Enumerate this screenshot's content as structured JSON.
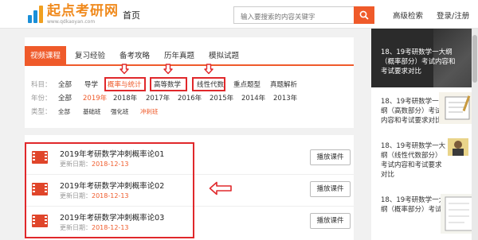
{
  "header": {
    "logo_name": "起点考研网",
    "logo_url": "www.qdkaoyan.com",
    "home_label": "首页",
    "search_placeholder": "输入要搜索的内容关键字",
    "advanced_search": "高级检索",
    "login": "登录/注册"
  },
  "tabs": [
    "视频课程",
    "复习经验",
    "备考攻略",
    "历年真题",
    "模拟试题"
  ],
  "filters": {
    "subject": {
      "label": "科目：",
      "options": [
        "全部",
        "导学",
        "概率与统计",
        "高等数学",
        "线性代数",
        "重点题型",
        "真题解析"
      ]
    },
    "year": {
      "label": "年份：",
      "options": [
        "全部",
        "2019年",
        "2018年",
        "2017年",
        "2016年",
        "2015年",
        "2014年",
        "2013年"
      ]
    },
    "type": {
      "label": "类型：",
      "options": [
        "全部",
        "基础班",
        "强化班",
        "冲刺班"
      ]
    }
  },
  "courses": [
    {
      "title": "2019年考研数学冲刺概率论01",
      "date_label": "更新日期：",
      "date": "2018-12-13",
      "button": "播放课件"
    },
    {
      "title": "2019年考研数学冲刺概率论02",
      "date_label": "更新日期：",
      "date": "2018-12-13",
      "button": "播放课件"
    },
    {
      "title": "2019年考研数学冲刺概率论03",
      "date_label": "更新日期：",
      "date": "2018-12-13",
      "button": "播放课件"
    }
  ],
  "sidebar": [
    {
      "text": [
        "18、19考研数学一大纲",
        "（概率部分）考试内容和",
        "考试要求对比"
      ]
    },
    {
      "text": [
        "18、19考研数学一大",
        "纲（高数部分）考试",
        "内容和考试要求对比"
      ]
    },
    {
      "text": [
        "18、19考研数学一大",
        "纲（线性代数部分）",
        "考试内容和考试要求",
        "对比"
      ]
    },
    {
      "text": [
        "18、19考研数学一大",
        "纲（概率部分）考试"
      ]
    }
  ],
  "colors": {
    "accent": "#ef5a2a",
    "annotation": "#e0282b"
  }
}
